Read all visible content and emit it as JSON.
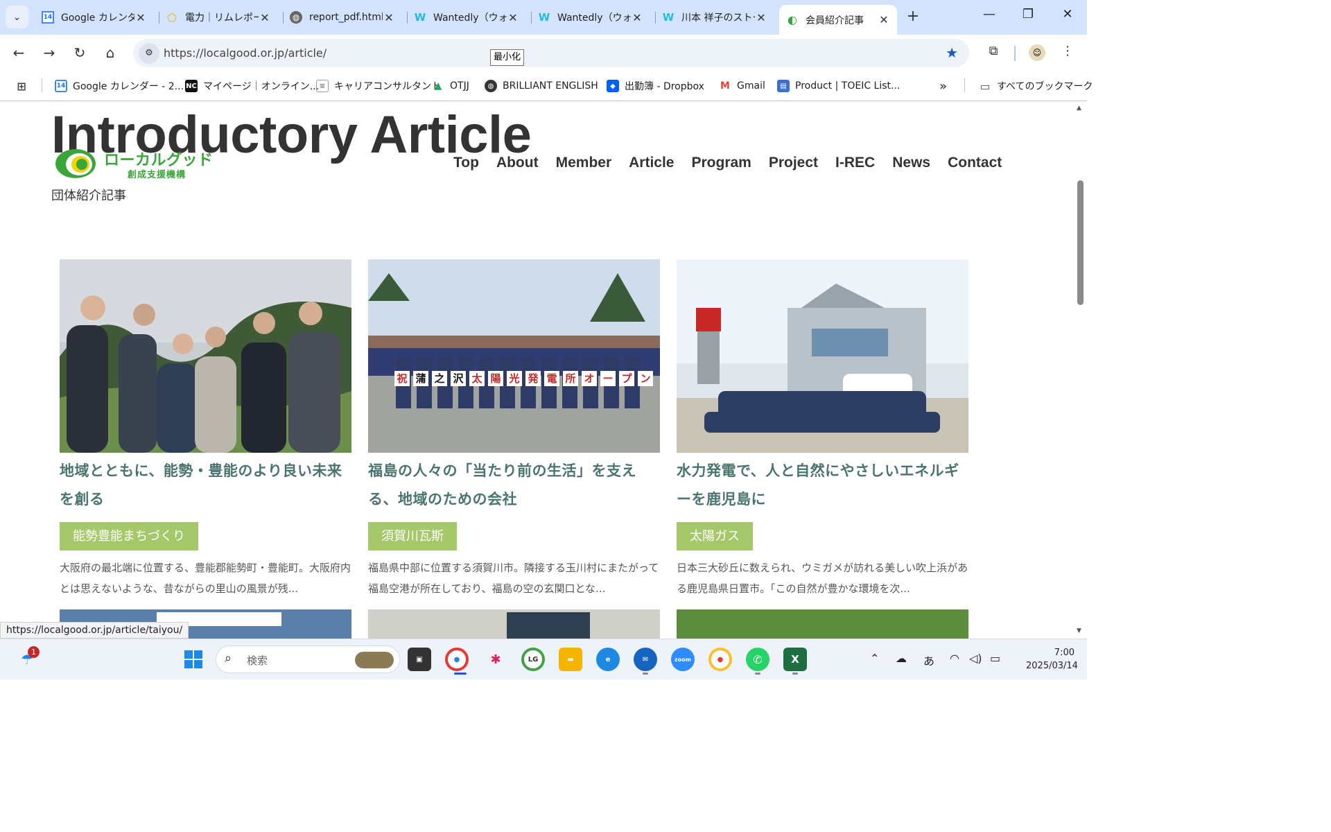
{
  "browser": {
    "tabs": [
      {
        "label": "Google カレンダー",
        "icon": "calendar-icon",
        "active": false
      },
      {
        "label": "電力｜リムレポート",
        "icon": "power-icon",
        "active": false
      },
      {
        "label": "report_pdf.html",
        "icon": "globe-icon",
        "active": false
      },
      {
        "label": "Wantedly（ウォンテッドリー）",
        "icon": "wantedly-icon",
        "active": false
      },
      {
        "label": "Wantedly（ウォンテッドリー）",
        "icon": "wantedly-icon",
        "active": false
      },
      {
        "label": "川本 祥子のストーリー",
        "icon": "wantedly-icon",
        "active": false
      },
      {
        "label": "会員紹介記事",
        "icon": "localgood-icon",
        "active": true
      }
    ],
    "url": "https://localgood.or.jp/article/",
    "tooltip": "最小化",
    "bookmarks": [
      {
        "label": "Google カレンダー - 2...",
        "icon": "calendar-icon"
      },
      {
        "label": "マイページ｜オンライン...",
        "icon": "nc-icon"
      },
      {
        "label": "キャリアコンサルタント",
        "icon": "doc-icon"
      },
      {
        "label": "OTJJ",
        "icon": "drive-icon"
      },
      {
        "label": "BRILLIANT ENGLISH",
        "icon": "globe-icon"
      },
      {
        "label": "出勤簿 - Dropbox",
        "icon": "dropbox-icon"
      },
      {
        "label": "Gmail",
        "icon": "gmail-icon"
      },
      {
        "label": "Product | TOEIC List...",
        "icon": "toeic-icon"
      }
    ],
    "all_bookmarks_label": "すべてのブックマーク",
    "status_url": "https://localgood.or.jp/article/taiyou/"
  },
  "page": {
    "hero_title": "Introductory Article",
    "logo_main": "ローカルグッド",
    "logo_sub": "創成支援機構",
    "nav": [
      "Top",
      "About",
      "Member",
      "Article",
      "Program",
      "Project",
      "I-REC",
      "News",
      "Contact"
    ],
    "subtitle": "団体紹介記事",
    "cards": [
      {
        "title": "地域とともに、能勢・豊能のより良い未来を創る",
        "tag": "能勢豊能まちづくり",
        "excerpt": "大阪府の最北端に位置する、豊能郡能勢町・豊能町。大阪府内とは思えないような、昔ながらの里山の風景が残..."
      },
      {
        "title": "福島の人々の「当たり前の生活」を支える、地域のための会社",
        "tag": "須賀川瓦斯",
        "excerpt": "福島県中部に位置する須賀川市。隣接する玉川村にまたがって福島空港が所在しており、福島の空の玄関口とな..."
      },
      {
        "title": "水力発電で、人と自然にやさしいエネルギーを鹿児島に",
        "tag": "太陽ガス",
        "excerpt": "日本三大砂丘に数えられ、ウミガメが訪れる美しい吹上浜がある鹿児島県日置市。「この自然が豊かな環境を次..."
      }
    ],
    "photo_signs": [
      "祝",
      "蒲",
      "之",
      "沢",
      "太",
      "陽",
      "光",
      "発",
      "電",
      "所",
      "オ",
      "ー",
      "プ",
      "ン"
    ]
  },
  "taskbar": {
    "search_placeholder": "検索",
    "notification_count": "1",
    "time": "7:00",
    "date": "2025/03/14",
    "ime": "あ"
  },
  "colors": {
    "accent_title": "#4a7470",
    "tag_bg": "#a5c96a",
    "logo_green": "#3aa63a",
    "tab_bar": "#d3e3fd"
  }
}
